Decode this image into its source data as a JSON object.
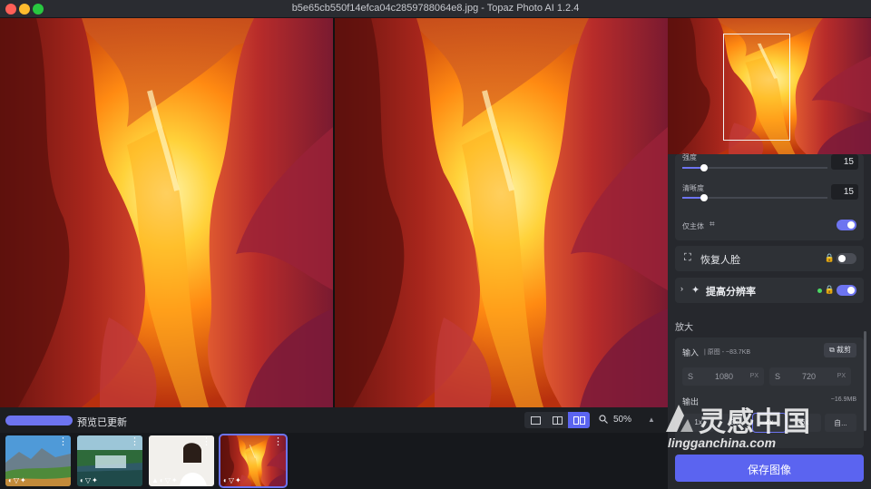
{
  "window": {
    "title": "b5e65cb550f14efca04c2859788064e8.jpg - Topaz Photo AI 1.2.4"
  },
  "bottom_bar": {
    "status": "预览已更新",
    "view_modes": [
      "single",
      "side-by-side-split",
      "side-by-side"
    ],
    "active_view": "side-by-side",
    "zoom": "50%"
  },
  "filmstrip": {
    "thumbnails": [
      {
        "name": "landscape-mountain",
        "active": false
      },
      {
        "name": "waterfall-forest",
        "active": false
      },
      {
        "name": "portrait-white",
        "active": false
      },
      {
        "name": "antelope-canyon",
        "active": true
      }
    ]
  },
  "sidebar": {
    "settings_panel": {
      "strength_label": "强度",
      "strength_value": "15",
      "strength_level": 0.15,
      "sharpness_label": "清晰度",
      "sharpness_value": "15",
      "sharpness_level": 0.15,
      "subject_only_label": "仅主体",
      "subject_only_on": true
    },
    "face_recovery": {
      "label": "恢复人脸",
      "enabled": false
    },
    "upscale": {
      "label": "提高分辨率",
      "enabled": true
    },
    "enlarge": {
      "section_title": "放大",
      "input_label": "输入",
      "input_sub": "| 原图 - ~83.7KB",
      "crop_label": "裁剪",
      "width": "1080",
      "height": "720",
      "w_prefix": "S",
      "h_prefix": "S",
      "unit": "PX",
      "output_label": "输出",
      "output_size": "~16.9MB",
      "scales": [
        "1x",
        "2x",
        "4x",
        "6x"
      ],
      "active_scale": "4x",
      "custom_label": "自..."
    },
    "save_label": "保存图像"
  },
  "watermark": {
    "cn": "灵感中国",
    "en": "lingganchina.com"
  },
  "colors": {
    "accent": "#5b64f0",
    "panel": "#2e3136",
    "sidebar": "#26282d"
  }
}
